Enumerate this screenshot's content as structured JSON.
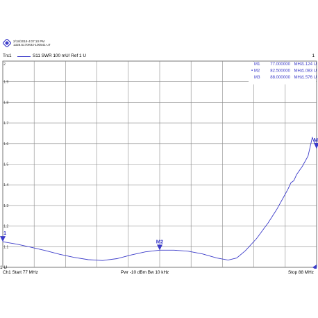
{
  "header": {
    "timestamp": "2/18/2019 4:07:10 PM",
    "device_id": "1328.5170K92-100541-uT"
  },
  "trace": {
    "name": "Trc1",
    "description": "S11  SWR  100 mU/ Ref 1 U",
    "channel_number": "1",
    "color": "#3b3bc9"
  },
  "status_bar": {
    "channel_start": "Ch1  Start  77 MHz",
    "power_bw": "Pwr  -10 dBm  Bw  10 kHz",
    "stop": "Stop  88 MHz"
  },
  "chart_data": {
    "type": "line",
    "xlim": [
      77,
      88
    ],
    "ylim": [
      1.0,
      2.0
    ],
    "grid": true,
    "y_tick_labels": [
      {
        "value": 2.0,
        "label": "2"
      },
      {
        "value": 1.9,
        "label": "1.9"
      },
      {
        "value": 1.8,
        "label": "1.8"
      },
      {
        "value": 1.7,
        "label": "1.7"
      },
      {
        "value": 1.6,
        "label": "1.6"
      },
      {
        "value": 1.5,
        "label": "1.5"
      },
      {
        "value": 1.4,
        "label": "1.4"
      },
      {
        "value": 1.3,
        "label": "1.3"
      },
      {
        "value": 1.2,
        "label": "1.2"
      },
      {
        "value": 1.1,
        "label": "1.1"
      },
      {
        "value": 1.0,
        "label": "1 U"
      }
    ],
    "series": [
      {
        "points": [
          [
            77.0,
            1.124
          ],
          [
            77.5,
            1.112
          ],
          [
            78.0,
            1.097
          ],
          [
            78.5,
            1.081
          ],
          [
            79.0,
            1.063
          ],
          [
            79.5,
            1.048
          ],
          [
            80.0,
            1.037
          ],
          [
            80.5,
            1.033
          ],
          [
            81.0,
            1.042
          ],
          [
            81.5,
            1.06
          ],
          [
            82.0,
            1.075
          ],
          [
            82.5,
            1.083
          ],
          [
            83.0,
            1.083
          ],
          [
            83.5,
            1.078
          ],
          [
            84.0,
            1.065
          ],
          [
            84.5,
            1.045
          ],
          [
            84.9,
            1.035
          ],
          [
            85.2,
            1.045
          ],
          [
            85.5,
            1.08
          ],
          [
            85.9,
            1.14
          ],
          [
            86.3,
            1.215
          ],
          [
            86.6,
            1.28
          ],
          [
            86.8,
            1.33
          ],
          [
            86.9,
            1.355
          ],
          [
            87.0,
            1.38
          ],
          [
            87.1,
            1.41
          ],
          [
            87.2,
            1.42
          ],
          [
            87.3,
            1.45
          ],
          [
            87.5,
            1.49
          ],
          [
            87.7,
            1.54
          ],
          [
            87.85,
            1.63
          ],
          [
            88.0,
            1.576
          ]
        ]
      }
    ],
    "markers": [
      {
        "name": "M1",
        "label": "1",
        "freq": "77.000000",
        "unit": "MHz",
        "value": "1.124",
        "value_unit": "U",
        "x": 77.0,
        "y": 1.124,
        "active": false
      },
      {
        "name": "M2",
        "label": "M2",
        "freq": "82.500000",
        "unit": "MHz",
        "value": "1.083",
        "value_unit": "U",
        "x": 82.5,
        "y": 1.083,
        "active": true
      },
      {
        "name": "M3",
        "label": "M",
        "freq": "88.000000",
        "unit": "MHz",
        "value": "1.576",
        "value_unit": "U",
        "x": 88.0,
        "y": 1.576,
        "active": false
      }
    ]
  }
}
